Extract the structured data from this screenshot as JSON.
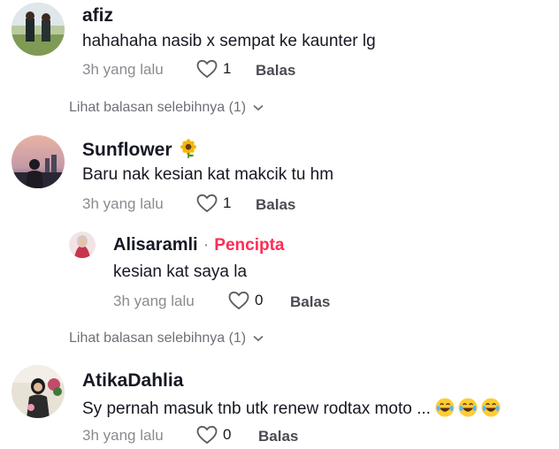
{
  "comments": [
    {
      "username": "afiz",
      "text": "hahahaha nasib x sempat ke kaunter lg",
      "time": "3h yang lalu",
      "likes": "1",
      "reply_label": "Balas",
      "more_replies": "Lihat balasan selebihnya (1)"
    },
    {
      "username": "Sunflower",
      "text": "Baru nak kesian kat makcik tu hm",
      "time": "3h yang lalu",
      "likes": "1",
      "reply_label": "Balas",
      "reply": {
        "username": "Alisaramli",
        "separator": "·",
        "badge": "Pencipta",
        "text": "kesian kat saya la",
        "time": "3h yang lalu",
        "likes": "0",
        "reply_label": "Balas"
      },
      "more_replies": "Lihat balasan selebihnya (1)"
    },
    {
      "username": "AtikaDahlia",
      "text": "Sy pernah masuk tnb utk renew rodtax moto ...",
      "time": "3h yang lalu",
      "likes": "0",
      "reply_label": "Balas"
    }
  ],
  "icons": {
    "like": "heart-outline-icon",
    "expand": "chevron-down-icon",
    "username_emoji": "sunflower-emoji",
    "text_emoji": "laughing-tears-emoji"
  }
}
